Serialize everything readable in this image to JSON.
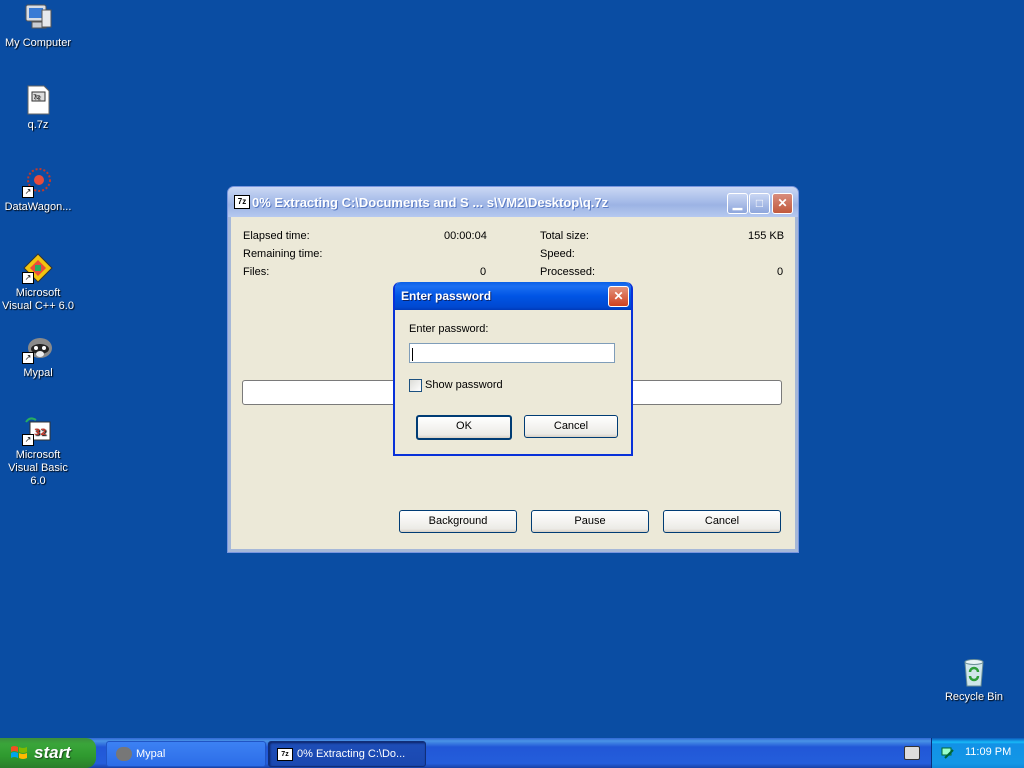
{
  "desktop": {
    "icons": [
      {
        "label": "My Computer"
      },
      {
        "label": "q.7z"
      },
      {
        "label": "DataWagon..."
      },
      {
        "label": "Microsoft Visual C++ 6.0"
      },
      {
        "label": "Mypal"
      },
      {
        "label": "Microsoft Visual Basic 6.0"
      },
      {
        "label": "Recycle Bin"
      }
    ]
  },
  "extract_window": {
    "app_icon": "7z",
    "title": "0% Extracting C:\\Documents and S ... s\\VM2\\Desktop\\q.7z",
    "elapsed_label": "Elapsed time:",
    "elapsed_value": "00:00:04",
    "remaining_label": "Remaining time:",
    "files_label": "Files:",
    "files_value": "0",
    "total_size_label": "Total size:",
    "total_size_value": "155 KB",
    "speed_label": "Speed:",
    "processed_label": "Processed:",
    "processed_value": "0",
    "progress": 0,
    "background_button": "Background",
    "pause_button": "Pause",
    "cancel_button": "Cancel"
  },
  "password_dialog": {
    "title": "Enter password",
    "prompt": "Enter password:",
    "password_value": "",
    "show_password_label": "Show password",
    "show_password_checked": false,
    "ok_button": "OK",
    "cancel_button": "Cancel"
  },
  "taskbar": {
    "start_label": "start",
    "items": [
      {
        "label": "Mypal",
        "active": false
      },
      {
        "label": "0% Extracting C:\\Do...",
        "active": true
      }
    ],
    "clock": "11:09 PM"
  },
  "colors": {
    "desktop": "#0a4da3",
    "dialog_titlebar": "#0055e5",
    "taskbar": "#245edb",
    "start_button": "#3aa53a"
  }
}
